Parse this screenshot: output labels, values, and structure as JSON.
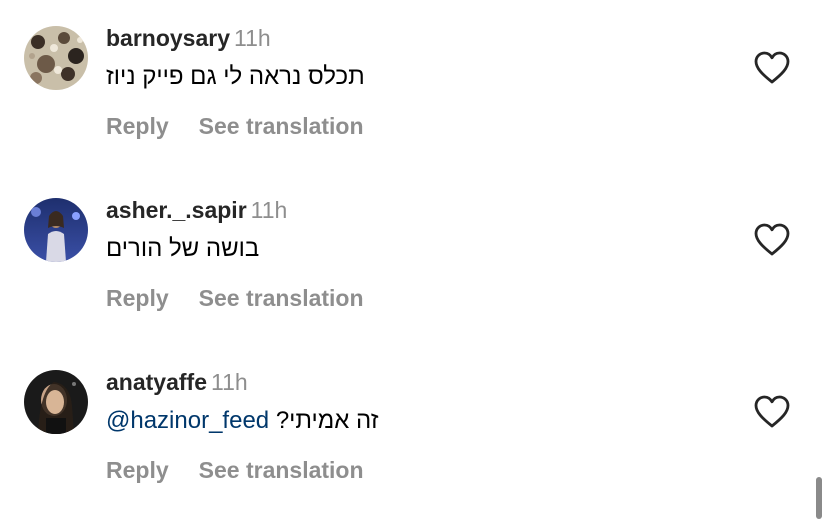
{
  "comments": [
    {
      "username": "barnoysary",
      "time": "11h",
      "text": "תכלס נראה לי גם פייק ניוז",
      "mention": "",
      "reply_label": "Reply",
      "translation_label": "See translation"
    },
    {
      "username": "asher._.sapir",
      "time": "11h",
      "text": "בושה של הורים",
      "mention": "",
      "reply_label": "Reply",
      "translation_label": "See translation"
    },
    {
      "username": "anatyaffe",
      "time": "11h",
      "text": "זה אמיתי?",
      "mention": "@hazinor_feed",
      "reply_label": "Reply",
      "translation_label": "See translation"
    }
  ],
  "icons": {
    "like": "heart-outline-icon"
  },
  "colors": {
    "username": "#262626",
    "meta": "#8e8e8e",
    "mention": "#00376b"
  }
}
